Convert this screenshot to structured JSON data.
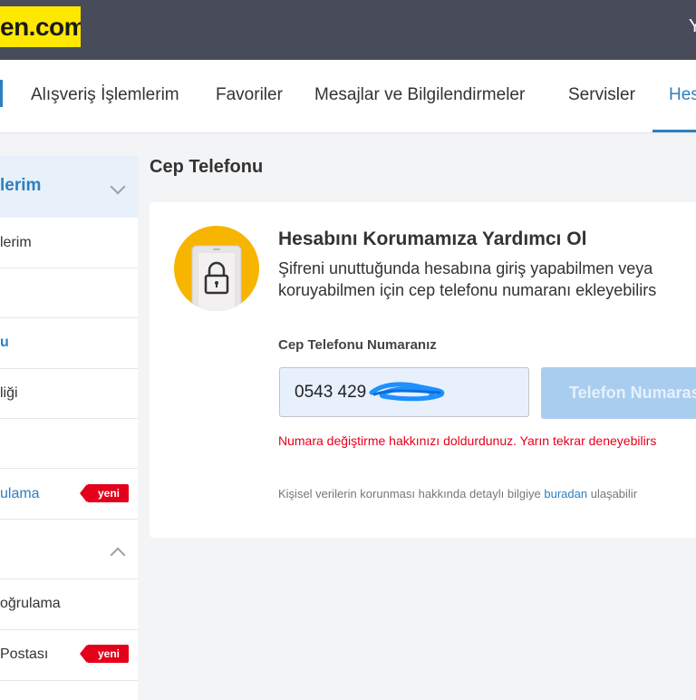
{
  "header": {
    "logo_text": "en.com",
    "right_text": "Y"
  },
  "nav": {
    "items": [
      {
        "label": "Alışveriş İşlemlerim"
      },
      {
        "label": "Favoriler"
      },
      {
        "label": "Mesajlar ve Bilgilendirmeler"
      },
      {
        "label": "Servisler"
      },
      {
        "label": "Hes"
      }
    ]
  },
  "sidebar": {
    "section1_title": "lerim",
    "items": [
      {
        "label": "lerim"
      },
      {
        "label": ""
      },
      {
        "label": "u"
      },
      {
        "label": "liği"
      },
      {
        "label": ""
      },
      {
        "label": "ulama",
        "badge": "yeni"
      },
      {
        "label": ""
      },
      {
        "label": "oğrulama"
      },
      {
        "label": "Postası",
        "badge": "yeni"
      }
    ]
  },
  "page": {
    "title": "Cep Telefonu"
  },
  "card": {
    "heading": "Hesabını Korumamıza Yardımcı Ol",
    "desc_line1": "Şifreni unuttuğunda hesabına giriş yapabilmen veya",
    "desc_line2": "koruyabilmen için cep telefonu numaranı ekleyebilirs",
    "field_label": "Cep Telefonu Numaranız",
    "phone_value": "0543 429",
    "submit_label": "Telefon Numarası",
    "error": "Numara değiştirme hakkınızı doldurdunuz. Yarın tekrar deneyebilirs",
    "privacy_prefix": "Kişisel verilerin korunması hakkında detaylı bilgiye",
    "privacy_link": "buradan",
    "privacy_suffix": "ulaşabilir"
  },
  "colors": {
    "brand_yellow": "#ffe800",
    "accent_blue": "#2d7fc1",
    "error_red": "#e4001b",
    "header_bg": "#484b5a"
  }
}
